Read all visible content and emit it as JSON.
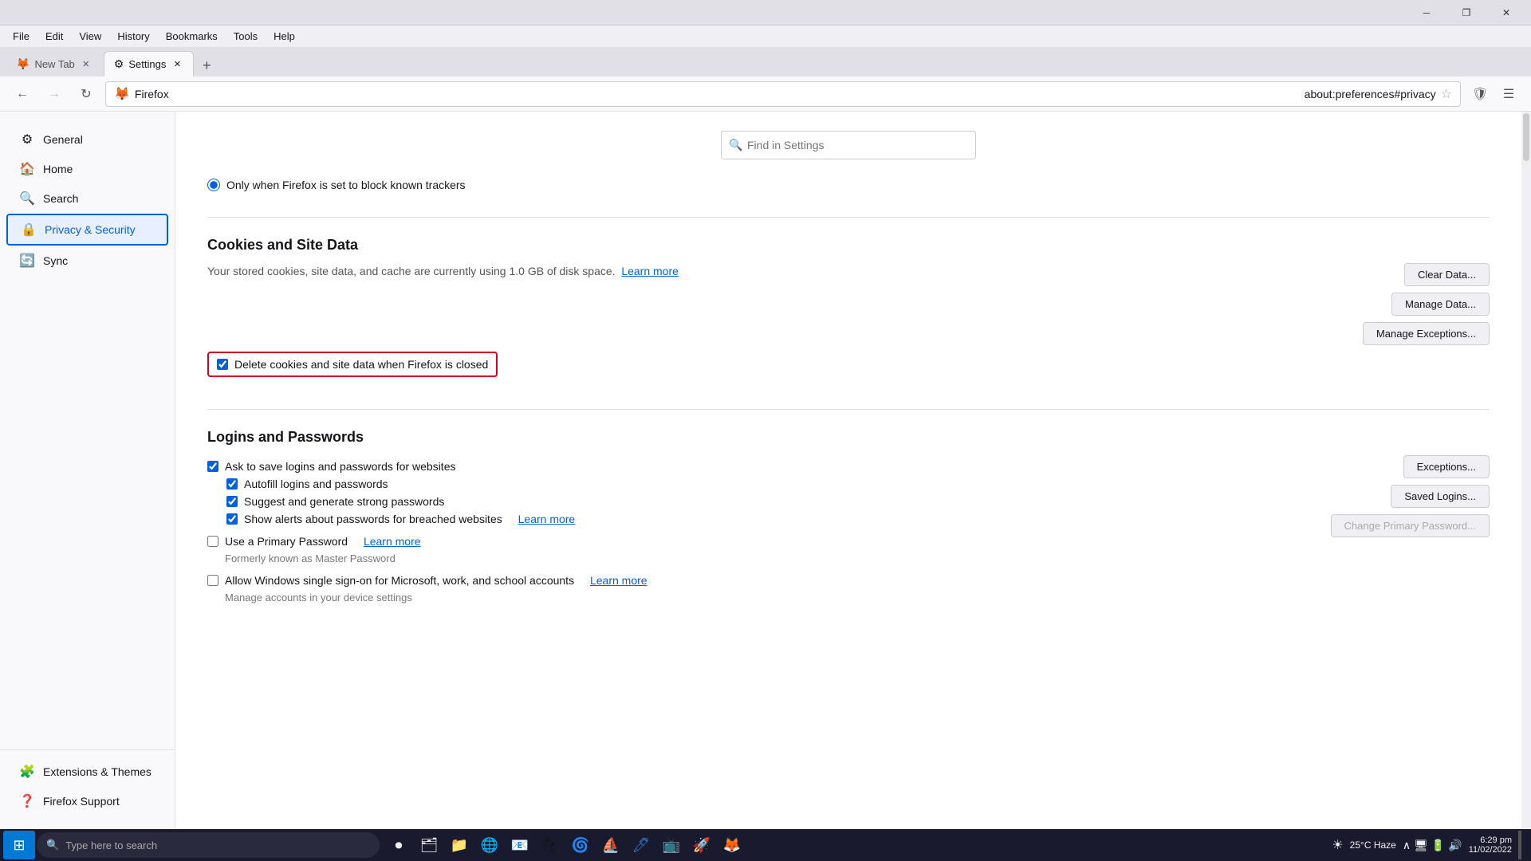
{
  "titlebar": {
    "minimize": "─",
    "maximize": "❐",
    "close": "✕"
  },
  "menubar": {
    "items": [
      "File",
      "Edit",
      "View",
      "History",
      "Bookmarks",
      "Tools",
      "Help"
    ]
  },
  "tabs": [
    {
      "id": "newtab",
      "label": "New Tab",
      "active": false,
      "icon": "🦊"
    },
    {
      "id": "settings",
      "label": "Settings",
      "active": true,
      "icon": "⚙"
    }
  ],
  "navbar": {
    "back_disabled": false,
    "forward_disabled": true,
    "address": "about:preferences#privacy",
    "firefox_label": "Firefox"
  },
  "sidebar": {
    "items": [
      {
        "id": "general",
        "label": "General",
        "icon": "⚙"
      },
      {
        "id": "home",
        "label": "Home",
        "icon": "🏠"
      },
      {
        "id": "search",
        "label": "Search",
        "icon": "🔍"
      },
      {
        "id": "privacy",
        "label": "Privacy & Security",
        "icon": "🔒",
        "active": true
      },
      {
        "id": "sync",
        "label": "Sync",
        "icon": "🔄"
      }
    ],
    "bottom_items": [
      {
        "id": "extensions",
        "label": "Extensions & Themes",
        "icon": "🧩"
      },
      {
        "id": "support",
        "label": "Firefox Support",
        "icon": "❓"
      }
    ]
  },
  "settings_search": {
    "placeholder": "Find in Settings"
  },
  "content": {
    "radio_section": {
      "radio_option": "Only when Firefox is set to block known trackers"
    },
    "cookies_section": {
      "title": "Cookies and Site Data",
      "description": "Your stored cookies, site data, and cache are currently using 1.0 GB of disk space.",
      "learn_more": "Learn more",
      "clear_data_btn": "Clear Data...",
      "manage_data_btn": "Manage Data...",
      "manage_exceptions_btn": "Manage Exceptions...",
      "delete_checkbox_label": "Delete cookies and site data when Firefox is closed"
    },
    "logins_section": {
      "title": "Logins and Passwords",
      "ask_save_label": "Ask to save logins and passwords for websites",
      "autofill_label": "Autofill logins and passwords",
      "suggest_label": "Suggest and generate strong passwords",
      "show_alerts_label": "Show alerts about passwords for breached websites",
      "show_alerts_learn_more": "Learn more",
      "primary_password_label": "Use a Primary Password",
      "primary_password_learn_more": "Learn more",
      "primary_password_note": "Formerly known as Master Password",
      "change_primary_btn": "Change Primary Password...",
      "windows_sso_label": "Allow Windows single sign-on for Microsoft, work, and school accounts",
      "windows_sso_learn_more": "Learn more",
      "windows_sso_note": "Manage accounts in your device settings",
      "exceptions_btn": "Exceptions...",
      "saved_logins_btn": "Saved Logins..."
    }
  },
  "taskbar": {
    "start_icon": "⊞",
    "search_placeholder": "Type here to search",
    "search_icon": "🔍",
    "items": [
      "⏺",
      "🗂",
      "📁",
      "🌐",
      "📧",
      "🛍",
      "🌀",
      "⛵",
      "🖊",
      "📺",
      "🚀",
      "🦊"
    ],
    "weather": "☀",
    "weather_temp": "25°C Haze",
    "time": "6:29 pm",
    "date": "11/02/2022",
    "tray_icons": [
      "∧",
      "🖥",
      "🔋",
      "🔊"
    ]
  }
}
